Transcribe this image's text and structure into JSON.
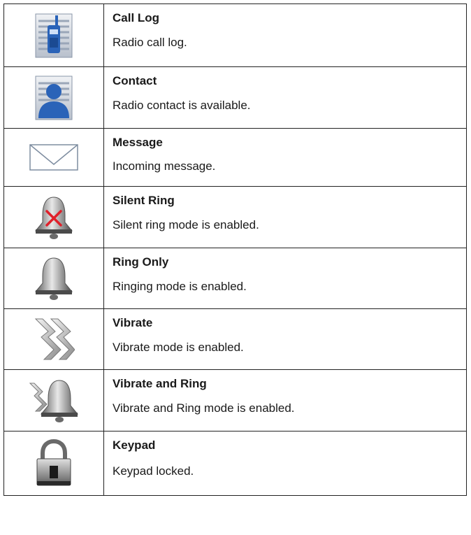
{
  "entries": [
    {
      "name": "Call Log",
      "description": "Radio call log.",
      "icon": "call-log-icon"
    },
    {
      "name": "Contact",
      "description": "Radio contact is available.",
      "icon": "contact-icon"
    },
    {
      "name": "Message",
      "description": "Incoming message.",
      "icon": "message-envelope-icon"
    },
    {
      "name": "Silent Ring",
      "description": "Silent ring mode is enabled.",
      "icon": "silent-ring-bell-icon"
    },
    {
      "name": "Ring Only",
      "description": "Ringing mode is enabled.",
      "icon": "ring-bell-icon"
    },
    {
      "name": "Vibrate",
      "description": "Vibrate mode is enabled.",
      "icon": "vibrate-icon"
    },
    {
      "name": "Vibrate and Ring",
      "description": "Vibrate and Ring mode is enabled.",
      "icon": "vibrate-ring-icon"
    },
    {
      "name": "Keypad",
      "description": "Keypad locked.",
      "icon": "padlock-icon"
    }
  ],
  "colors": {
    "border": "#222222",
    "icon_blue": "#2a63b8",
    "bell_gray": "#7a7a7a",
    "cross_red": "#e0202a"
  }
}
